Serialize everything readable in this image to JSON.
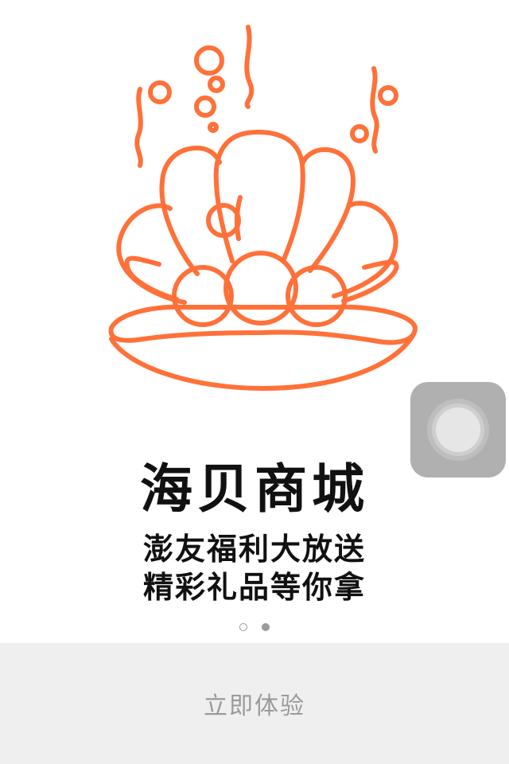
{
  "logo": {
    "icon": "shell-pearl-icon",
    "color": "#ff7139"
  },
  "headline": "海贝商城",
  "subline1": "澎友福利大放送",
  "subline2": "精彩礼品等你拿",
  "pager": {
    "count": 2,
    "active": 2
  },
  "cta": {
    "label": "立即体验"
  },
  "colors": {
    "accent": "#ff7139",
    "cta_bg": "#efefef",
    "cta_text": "#9a9a9a",
    "text": "#111111"
  }
}
